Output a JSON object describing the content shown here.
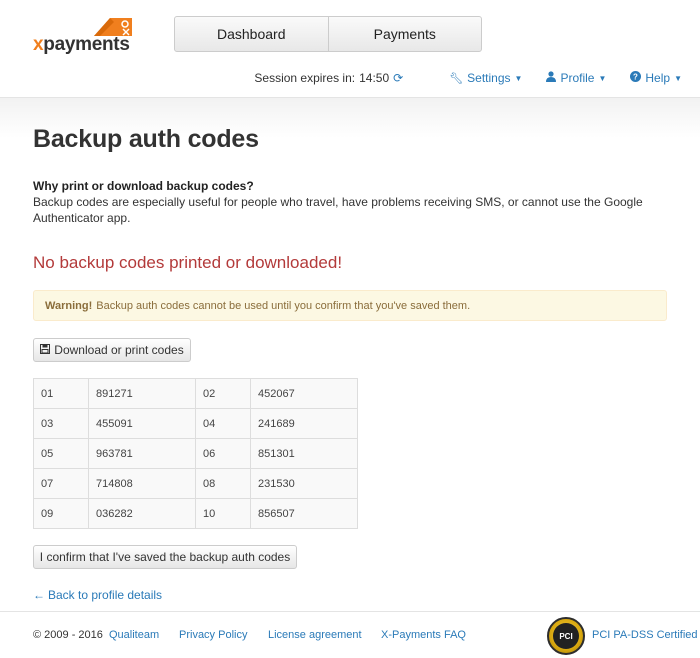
{
  "header": {
    "logo_prefix": "x",
    "logo_rest": "payments",
    "tabs": [
      {
        "label": "Dashboard"
      },
      {
        "label": "Payments"
      }
    ],
    "session_label": "Session expires in:",
    "session_time": "14:50",
    "menu": {
      "settings": "Settings",
      "profile": "Profile",
      "help": "Help"
    }
  },
  "main": {
    "title": "Backup auth codes",
    "why_title": "Why print or download backup codes?",
    "why_text": "Backup codes are especially useful for people who travel, have problems receiving SMS, or cannot use the Google Authenticator app.",
    "status_message": "No backup codes printed or downloaded!",
    "warning_label": "Warning!",
    "warning_text": "Backup auth codes cannot be used until you confirm that you've saved them.",
    "download_button": "Download or print codes",
    "codes": [
      {
        "n1": "01",
        "c1": "891271",
        "n2": "02",
        "c2": "452067"
      },
      {
        "n1": "03",
        "c1": "455091",
        "n2": "04",
        "c2": "241689"
      },
      {
        "n1": "05",
        "c1": "963781",
        "n2": "06",
        "c2": "851301"
      },
      {
        "n1": "07",
        "c1": "714808",
        "n2": "08",
        "c2": "231530"
      },
      {
        "n1": "09",
        "c1": "036282",
        "n2": "10",
        "c2": "856507"
      }
    ],
    "confirm_button": "I confirm that I've saved the backup auth codes",
    "back_link": "Back to profile details"
  },
  "footer": {
    "copyright": "© 2009 - 2016",
    "links": [
      "Qualiteam",
      "Privacy Policy",
      "License agreement",
      "X-Payments FAQ"
    ],
    "pci_label": "PCI PA-DSS Certified",
    "pci_badge": "PCI"
  },
  "colors": {
    "link": "#2a7ab8",
    "danger": "#b33a3a",
    "warning_bg": "#fcf8e3",
    "warning_text": "#8a6d3b",
    "brand_orange": "#f07f1e"
  },
  "icons": {
    "refresh": "refresh-icon",
    "settings": "wrench-icon",
    "profile": "user-icon",
    "help": "question-circle-icon",
    "download": "floppy-disk-icon",
    "back": "left-arrow-icon"
  }
}
